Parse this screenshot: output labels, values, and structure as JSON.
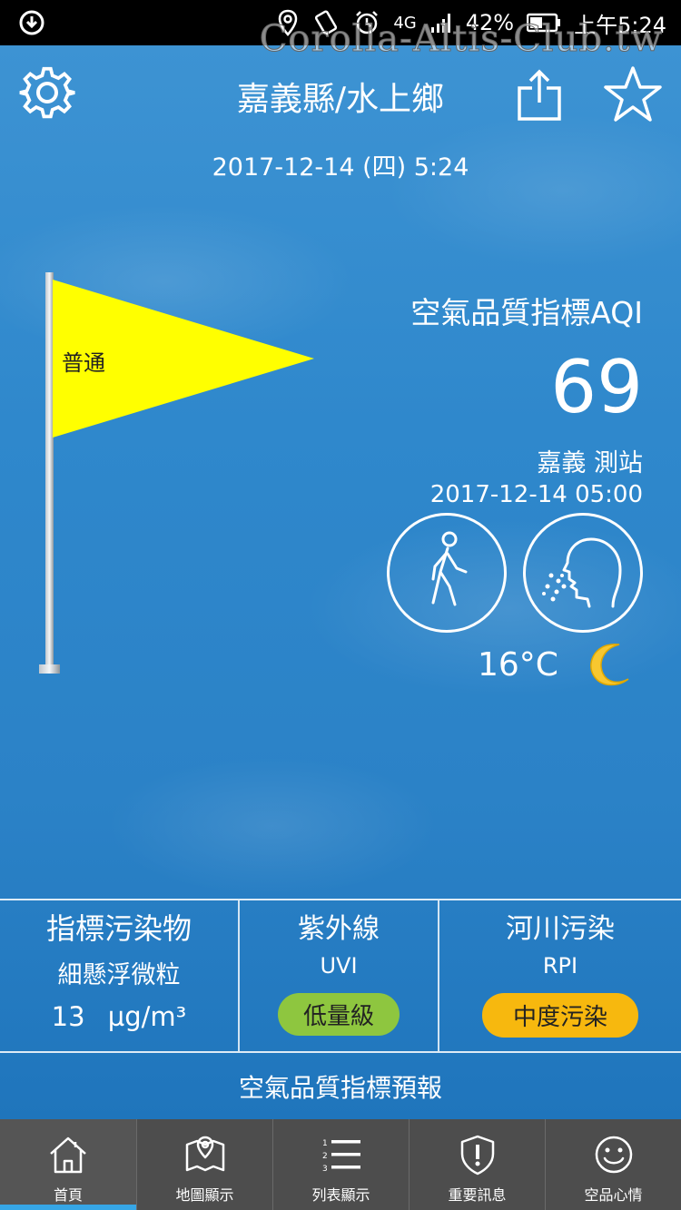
{
  "status_bar": {
    "battery": "42%",
    "network": "4G",
    "time": "上午5:24",
    "watermark": "Corolla-Altis-Club.tw"
  },
  "header": {
    "location": "嘉義縣/水上鄉",
    "datetime": "2017-12-14 (四) 5:24"
  },
  "flag": {
    "status_label": "普通",
    "color": "#ffff00"
  },
  "aqi": {
    "title": "空氣品質指標AQI",
    "value": "69",
    "station": "嘉義 測站",
    "time": "2017-12-14 05:00"
  },
  "weather": {
    "temperature": "16°C",
    "icon": "moon-icon"
  },
  "panels": {
    "pollutant": {
      "title": "指標污染物",
      "name": "細懸浮微粒",
      "value": "13",
      "unit": "µg/m³"
    },
    "uvi": {
      "title": "紫外線",
      "code": "UVI",
      "level": "低量級",
      "color": "#8ec63f"
    },
    "rpi": {
      "title": "河川污染",
      "code": "RPI",
      "level": "中度污染",
      "color": "#f7b80e"
    }
  },
  "forecast_label": "空氣品質指標預報",
  "tabs": [
    {
      "label": "首頁",
      "icon": "home-icon",
      "active": true
    },
    {
      "label": "地圖顯示",
      "icon": "map-icon",
      "active": false
    },
    {
      "label": "列表顯示",
      "icon": "list-icon",
      "active": false
    },
    {
      "label": "重要訊息",
      "icon": "alert-shield-icon",
      "active": false
    },
    {
      "label": "空品心情",
      "icon": "smiley-icon",
      "active": false
    }
  ]
}
